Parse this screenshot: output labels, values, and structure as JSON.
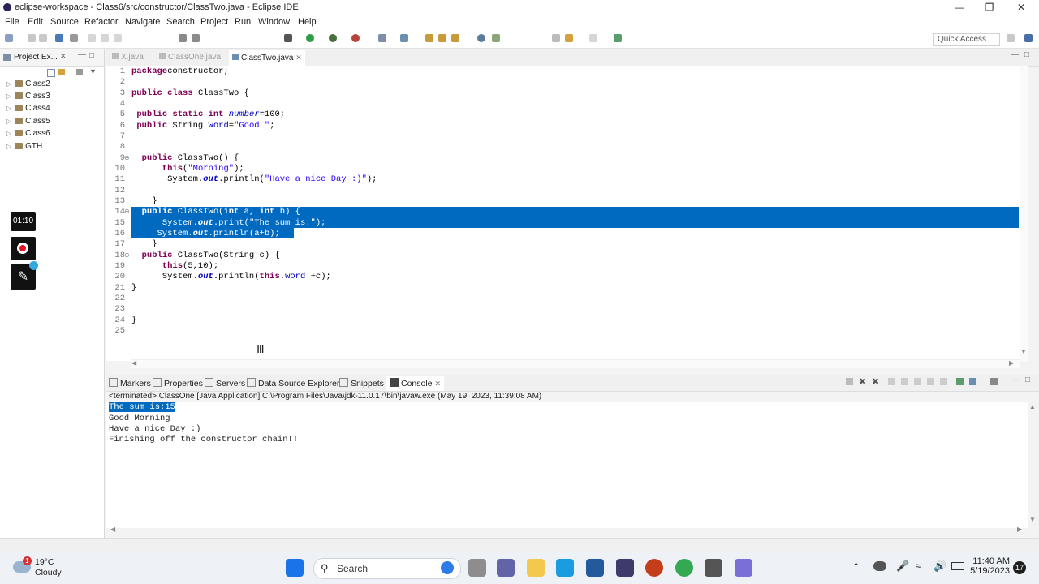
{
  "window": {
    "title": "eclipse-workspace - Class6/src/constructor/ClassTwo.java - Eclipse IDE"
  },
  "menu": [
    "File",
    "Edit",
    "Source",
    "Refactor",
    "Navigate",
    "Search",
    "Project",
    "Run",
    "Window",
    "Help"
  ],
  "toolbar": {
    "quick_access": "Quick Access"
  },
  "project_explorer": {
    "tab": "Project Ex...",
    "items": [
      "Class2",
      "Class3",
      "Class4",
      "Class5",
      "Class6",
      "GTH"
    ]
  },
  "recorder": {
    "timer": "01:10"
  },
  "editor": {
    "tabs": [
      "X.java",
      "ClassOne.java",
      "ClassTwo.java"
    ],
    "active_tab": "ClassTwo.java",
    "line_numbers": [
      "1",
      "2",
      "3",
      "4",
      "5",
      "6",
      "7",
      "8",
      "9",
      "10",
      "11",
      "12",
      "13",
      "14",
      "15",
      "16",
      "17",
      "18",
      "19",
      "20",
      "21",
      "22",
      "23",
      "24",
      "25"
    ]
  },
  "bottom_panel": {
    "tabs": [
      "Markers",
      "Properties",
      "Servers",
      "Data Source Explorer",
      "Snippets",
      "Console"
    ],
    "console_header": "<terminated> ClassOne [Java Application] C:\\Program Files\\Java\\jdk-11.0.17\\bin\\javaw.exe (May 19, 2023, 11:39:08 AM)",
    "output": [
      "The sum is:15",
      "Good Morning",
      "Have a nice Day :)",
      "Finishing off the constructor chain!!"
    ]
  },
  "taskbar": {
    "temperature": "19°C",
    "weather": "Cloudy",
    "weather_badge": "1",
    "search": "Search",
    "time": "11:40 AM",
    "date": "5/19/2023",
    "notifications": "17"
  },
  "colors": {
    "selection": "#0069c0",
    "keyword": "#7f0055",
    "string": "#2a00ff",
    "field": "#0000c0"
  }
}
